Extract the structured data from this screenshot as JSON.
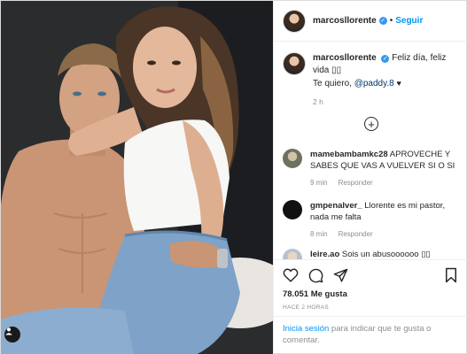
{
  "post": {
    "username": "marcosllorente",
    "follow_label": "Seguir",
    "separator": "•",
    "caption_line1": "Feliz día, feliz vida ▯▯",
    "caption_line2_prefix": "Te quiero, ",
    "caption_mention": "@paddy.8",
    "caption_heart": "♥",
    "caption_time": "2 h",
    "load_more_label": "+"
  },
  "comments": [
    {
      "username": "mamebambamkc28",
      "text": "APROVECHE Y SABES QUE VAS A VUELVER SI O SI",
      "time": "9 min",
      "reply_label": "Responder",
      "avatar_color": "#8a8f7a"
    },
    {
      "username": "gmpenalver_",
      "text": "Llorente es mi pastor, nada me falta",
      "time": "8 min",
      "reply_label": "Responder",
      "avatar_color": "#111111"
    },
    {
      "username": "leire.ao",
      "text": "Sois un abusoooooo ▯▯",
      "time": "",
      "reply_label": "",
      "avatar_color": "#c8d3de"
    }
  ],
  "actions": {
    "likes": "78.051 Me gusta",
    "time_ago": "HACE 2 HORAS"
  },
  "login": {
    "link_label": "Inicia sesión",
    "rest_text": " para indicar que te gusta o comentar."
  },
  "colors": {
    "accent": "#0095f6",
    "verified": "#3897f0",
    "muted": "#8e8e8e",
    "text": "#262626"
  },
  "icons": [
    "verified-badge-icon",
    "plus-circle-icon",
    "heart-icon",
    "comment-icon",
    "share-icon",
    "bookmark-icon",
    "user-tag-icon"
  ]
}
